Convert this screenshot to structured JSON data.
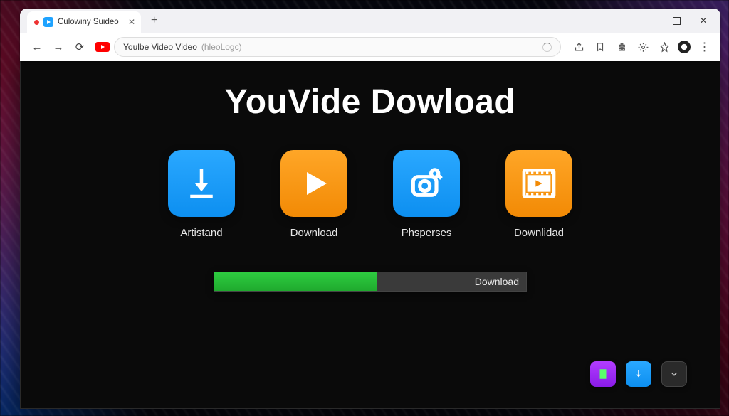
{
  "browser": {
    "tab": {
      "title": "Culowiny Suideo"
    },
    "address": {
      "text": "Youlbe Video Video",
      "hint": "(hleoLogc)"
    }
  },
  "page": {
    "heading": "YouVide Dowload",
    "tiles": [
      {
        "id": "artistand",
        "label": "Artistand",
        "color": "blue",
        "icon": "download"
      },
      {
        "id": "download",
        "label": "Download",
        "color": "orange",
        "icon": "play"
      },
      {
        "id": "phsperses",
        "label": "Phsperses",
        "color": "blue",
        "icon": "camera"
      },
      {
        "id": "downlidad",
        "label": "Downlidad",
        "color": "orange",
        "icon": "film"
      }
    ],
    "progress": {
      "percent": 52,
      "label": "Download"
    }
  },
  "colors": {
    "blue": "#149bf1",
    "orange": "#f28a05",
    "green": "#23c22e",
    "purple": "#9a22ee"
  }
}
